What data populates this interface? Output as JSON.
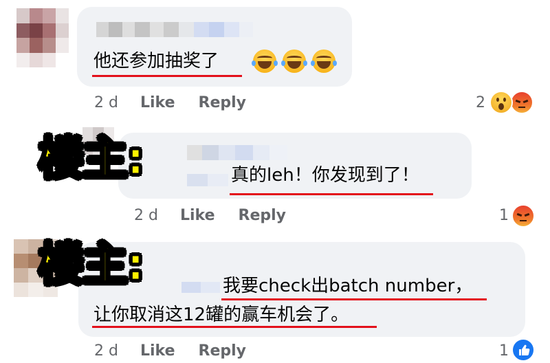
{
  "comments": [
    {
      "text": "他还参加抽奖了",
      "emoji_count": 3,
      "timestamp": "2 d",
      "like_label": "Like",
      "reply_label": "Reply",
      "reaction_count": "2",
      "reactions": [
        "wow-emoji",
        "angry-emoji"
      ]
    },
    {
      "label": "楼主:",
      "text": "真的leh！你发现到了！",
      "timestamp": "2 d",
      "like_label": "Like",
      "reply_label": "Reply",
      "reaction_count": "1",
      "reactions": [
        "angry-emoji"
      ]
    },
    {
      "label": "楼主:",
      "text_line1": "我要check出batch number，",
      "text_line2": "让你取消这12罐的赢车机会了。",
      "timestamp": "2 d",
      "like_label": "Like",
      "reply_label": "Reply",
      "reaction_count": "1",
      "reactions": [
        "like-emoji"
      ]
    }
  ],
  "colors": {
    "bubble": "#f0f2f5",
    "underline": "#e3101b",
    "label_fill": "#fff200",
    "meta_text": "#65676b",
    "like_blue": "#1877f2",
    "angry_red": "#e8412e"
  }
}
